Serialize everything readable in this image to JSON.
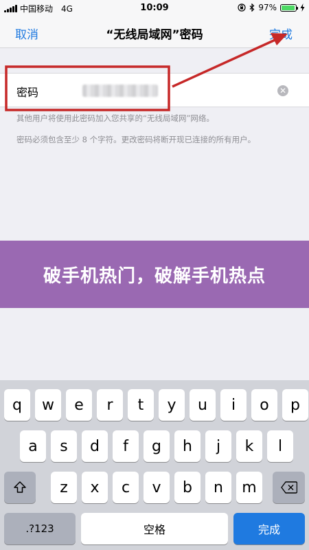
{
  "status_bar": {
    "carrier": "中国移动",
    "network": "4G",
    "time": "10:09",
    "battery": "97%",
    "battery_level": 0.97,
    "icons": [
      "signal-icon",
      "lock-rotation-icon",
      "bluetooth-icon",
      "battery-icon",
      "charging-icon"
    ]
  },
  "nav": {
    "cancel": "取消",
    "title": "“无线局域网”密码",
    "done": "完成"
  },
  "password": {
    "label": "密码"
  },
  "hints": [
    "其他用户将使用此密码加入您共享的“无线局域网”网络。",
    "密码必须包含至少 8 个字符。更改密码将断开现已连接的所有用户。"
  ],
  "banner": {
    "text": "破手机热门，破解手机热点"
  },
  "keyboard": {
    "row1": [
      "q",
      "w",
      "e",
      "r",
      "t",
      "y",
      "u",
      "i",
      "o",
      "p"
    ],
    "row2": [
      "a",
      "s",
      "d",
      "f",
      "g",
      "h",
      "j",
      "k",
      "l"
    ],
    "row3": [
      "z",
      "x",
      "c",
      "v",
      "b",
      "n",
      "m"
    ],
    "numbers": ".?123",
    "space": "空格",
    "done": "完成"
  },
  "colors": {
    "accent": "#1f7ae0",
    "annotation": "#c62828",
    "banner": "#9a69b2"
  }
}
